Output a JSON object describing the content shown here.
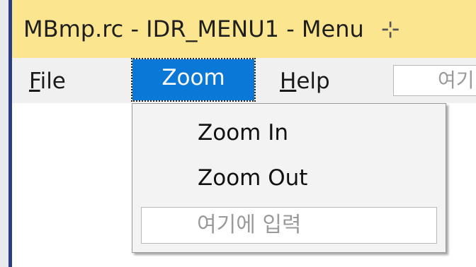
{
  "window": {
    "title": "MBmp.rc - IDR_MENU1 - Menu",
    "pin_glyph": "⊹"
  },
  "menu_bar": {
    "items": [
      {
        "accel": "F",
        "rest": "ile"
      },
      {
        "label": "Zoom"
      },
      {
        "accel": "H",
        "rest": "elp"
      }
    ],
    "type_here_placeholder": "여기"
  },
  "dropdown": {
    "items": [
      "Zoom In",
      "Zoom Out"
    ],
    "type_here_placeholder": "여기에 입력"
  },
  "colors": {
    "title_bar": "#fbe58e",
    "selection": "#0a78d7",
    "menu_bar": "#f0f0f0",
    "window_border": "#2b3c86"
  }
}
